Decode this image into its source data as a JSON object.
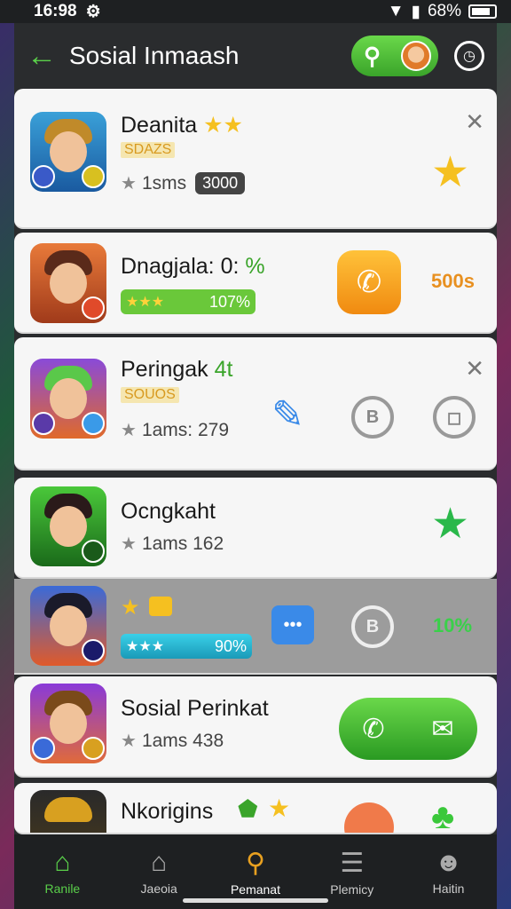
{
  "status": {
    "time": "16:98",
    "battery": "68%"
  },
  "header": {
    "title": "Sosial Inmaash"
  },
  "cards": [
    {
      "name": "Deanita",
      "sub": "SDAZS",
      "meta": "1sms",
      "pill": "3000",
      "stars_text": "★★"
    },
    {
      "name": "Dnagjala: 0:",
      "name_accent": "%",
      "bar_value": "107%",
      "side_value": "500s"
    },
    {
      "name": "Peringak",
      "name_accent": "4t",
      "sub": "SOUOS",
      "meta": "1ams: 279"
    },
    {
      "name": "Ocngkaht",
      "meta": "1ams 162"
    },
    {
      "bar_value": "90%",
      "side_value": "10%"
    },
    {
      "name": "Sosial Perinkat",
      "meta": "1ams 438"
    },
    {
      "name": "Nkorigins"
    }
  ],
  "nav": [
    {
      "label": "Ranile",
      "icon": "home-icon"
    },
    {
      "label": "Jaeoia",
      "icon": "house-icon"
    },
    {
      "label": "Pemanat",
      "icon": "search-icon"
    },
    {
      "label": "Plemicy",
      "icon": "list-icon"
    },
    {
      "label": "Haitin",
      "icon": "person-icon"
    }
  ],
  "colors": {
    "accent": "#5ad04a",
    "gold": "#e89020",
    "card": "#f6f6f6"
  }
}
